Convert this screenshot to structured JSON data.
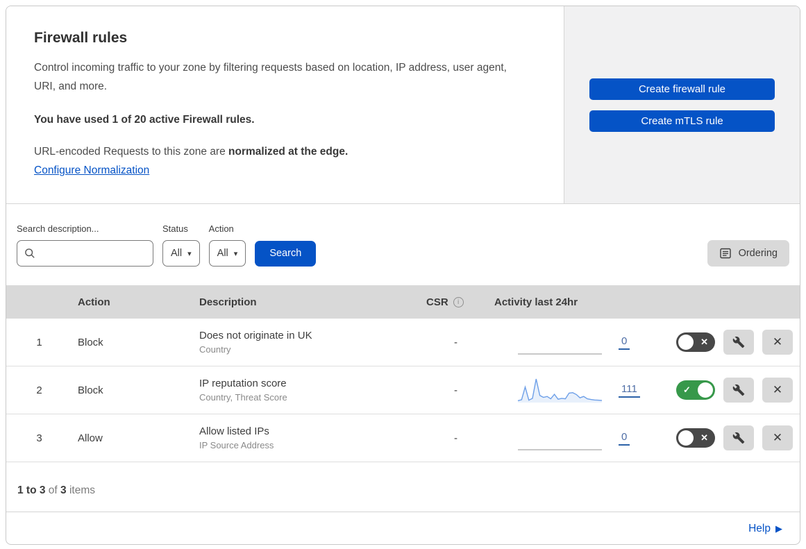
{
  "colors": {
    "primary_blue": "#0553c6",
    "link_blue": "#0553c6",
    "toggle_on_green": "#37984a",
    "toggle_off_gray": "#484848",
    "sparkline": "#6d9fe8",
    "sparkline_fill": "rgba(110,160,230,0.16)",
    "panel_gray": "#f1f1f2",
    "table_header_gray": "#d9d9d9"
  },
  "icons": {
    "search": "magnifier-icon",
    "ordering": "list-document-icon",
    "wrench": "wrench-icon",
    "dropdown_arrow": "▾",
    "toggle_on": "✓",
    "toggle_off": "✕",
    "close": "✕",
    "help_arrow": "▶",
    "info": "i"
  },
  "header": {
    "title": "Firewall rules",
    "description": "Control incoming traffic to your zone by filtering requests based on location, IP address, user agent, URI, and more.",
    "usage": "You have used 1 of 20 active Firewall rules.",
    "normalization_text": "URL-encoded Requests to this zone are ",
    "normalization_bold": "normalized at the edge.",
    "normalization_link": "Configure Normalization",
    "create_firewall_rule": "Create firewall rule",
    "create_mtls_rule": "Create mTLS rule"
  },
  "filters": {
    "search_label": "Search description...",
    "status_label": "Status",
    "status_value": "All",
    "action_label": "Action",
    "action_value": "All",
    "search_button": "Search",
    "ordering_button": "Ordering"
  },
  "table": {
    "columns": {
      "action": "Action",
      "description": "Description",
      "csr": "CSR",
      "activity": "Activity last 24hr"
    },
    "rows": [
      {
        "number": "1",
        "action": "Block",
        "description": "Does not originate in UK",
        "fields": "Country",
        "csr": "-",
        "count": "0",
        "enabled": false,
        "activity_values": null
      },
      {
        "number": "2",
        "action": "Block",
        "description": "IP reputation score",
        "fields": "Country, Threat Score",
        "csr": "-",
        "count": "111",
        "enabled": true,
        "activity_values": [
          8,
          12,
          66,
          10,
          18,
          100,
          30,
          22,
          26,
          16,
          35,
          14,
          18,
          16,
          40,
          42,
          34,
          20,
          26,
          16,
          13,
          11,
          10,
          9
        ]
      },
      {
        "number": "3",
        "action": "Allow",
        "description": "Allow listed IPs",
        "fields": "IP Source Address",
        "csr": "-",
        "count": "0",
        "enabled": false,
        "activity_values": null
      }
    ],
    "summary": {
      "range": "1 to 3",
      "of": "of",
      "total": "3",
      "items": "items"
    }
  },
  "footer": {
    "help": "Help"
  }
}
